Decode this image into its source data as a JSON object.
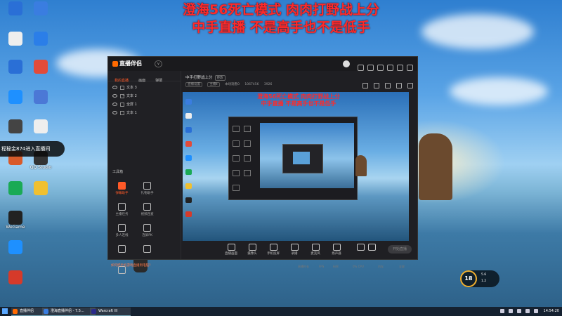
{
  "overlay": {
    "line1": "澄海56死亡模式 肉肉打野战上分",
    "line2": "中手直播 不是高手也不是低手",
    "toast": "程秘金874进入直播间",
    "color": "#ff2a2a"
  },
  "desktop": {
    "icons": [
      {
        "label": "",
        "color": "#2a6fd6"
      },
      {
        "label": "",
        "color": "#3a7de0"
      },
      {
        "label": "",
        "color": "#eeeeee"
      },
      {
        "label": "",
        "color": "#2b7ee8"
      },
      {
        "label": "",
        "color": "#2a6fd6"
      },
      {
        "label": "",
        "color": "#e24b3a"
      },
      {
        "label": "",
        "color": "#1e90ff"
      },
      {
        "label": "",
        "color": "#4b78d6"
      },
      {
        "label": "",
        "color": "#444444"
      },
      {
        "label": "",
        "color": "#eeeeee"
      },
      {
        "label": "",
        "color": "#d85a2a"
      },
      {
        "label": "QQ Studio",
        "color": "#333333"
      },
      {
        "label": "",
        "color": "#1aaa55"
      },
      {
        "label": "",
        "color": "#f0c030"
      },
      {
        "label": "WeGame",
        "color": "#222222"
      },
      {
        "label": "",
        "color": "#1e90ff"
      },
      {
        "label": "",
        "color": "#d63a2a"
      }
    ]
  },
  "app": {
    "logo": "直播伴侣",
    "version": "v",
    "tabs": [
      "我的直播",
      "画面",
      "弹幕"
    ],
    "sources": [
      "文本 3",
      "文本 2",
      "全屏 1",
      "文本 1"
    ],
    "tools_title": "工具箱",
    "tools": [
      {
        "label": "弹幕助手",
        "hot": true
      },
      {
        "label": "礼物助手",
        "hot": false
      },
      {
        "label": "主播任务",
        "hot": false
      },
      {
        "label": "视频连麦",
        "hot": false
      },
      {
        "label": "多人连线",
        "hot": false
      },
      {
        "label": "连屏PK",
        "hot": false
      },
      {
        "label": "",
        "hot": false
      },
      {
        "label": "",
        "hot": false
      },
      {
        "label": "",
        "hot": false
      }
    ],
    "notice": "如何把手机游戏直播到电脑?",
    "room_title": "中手打野战上分",
    "room_tag": "更改",
    "room_info": {
      "chip1": "直播设置",
      "chip2": "主播Ⅱ",
      "viewers": "本场观看0",
      "fans": "1067456",
      "likes": "3926"
    },
    "toolbar": [
      "直播画面",
      "摄像头",
      "手机投屏",
      "录播",
      "麦克风",
      "扬声器"
    ],
    "go_live": "开始直播",
    "status": [
      "直播时长",
      "FPS",
      "码率",
      "0% CPU",
      "内存",
      "全屏"
    ]
  },
  "taskbar": {
    "items": [
      {
        "label": "直播伴侣",
        "color": "#ff6a00"
      },
      {
        "label": "澄海直播伴侣 - 7.5...",
        "color": "#3a7de0"
      },
      {
        "label": "Warcraft III",
        "color": "#2a2a8a"
      }
    ],
    "clock": "14:54:20"
  },
  "badge": {
    "level": "18",
    "stat1": "5.6",
    "stat2": "1.2"
  }
}
